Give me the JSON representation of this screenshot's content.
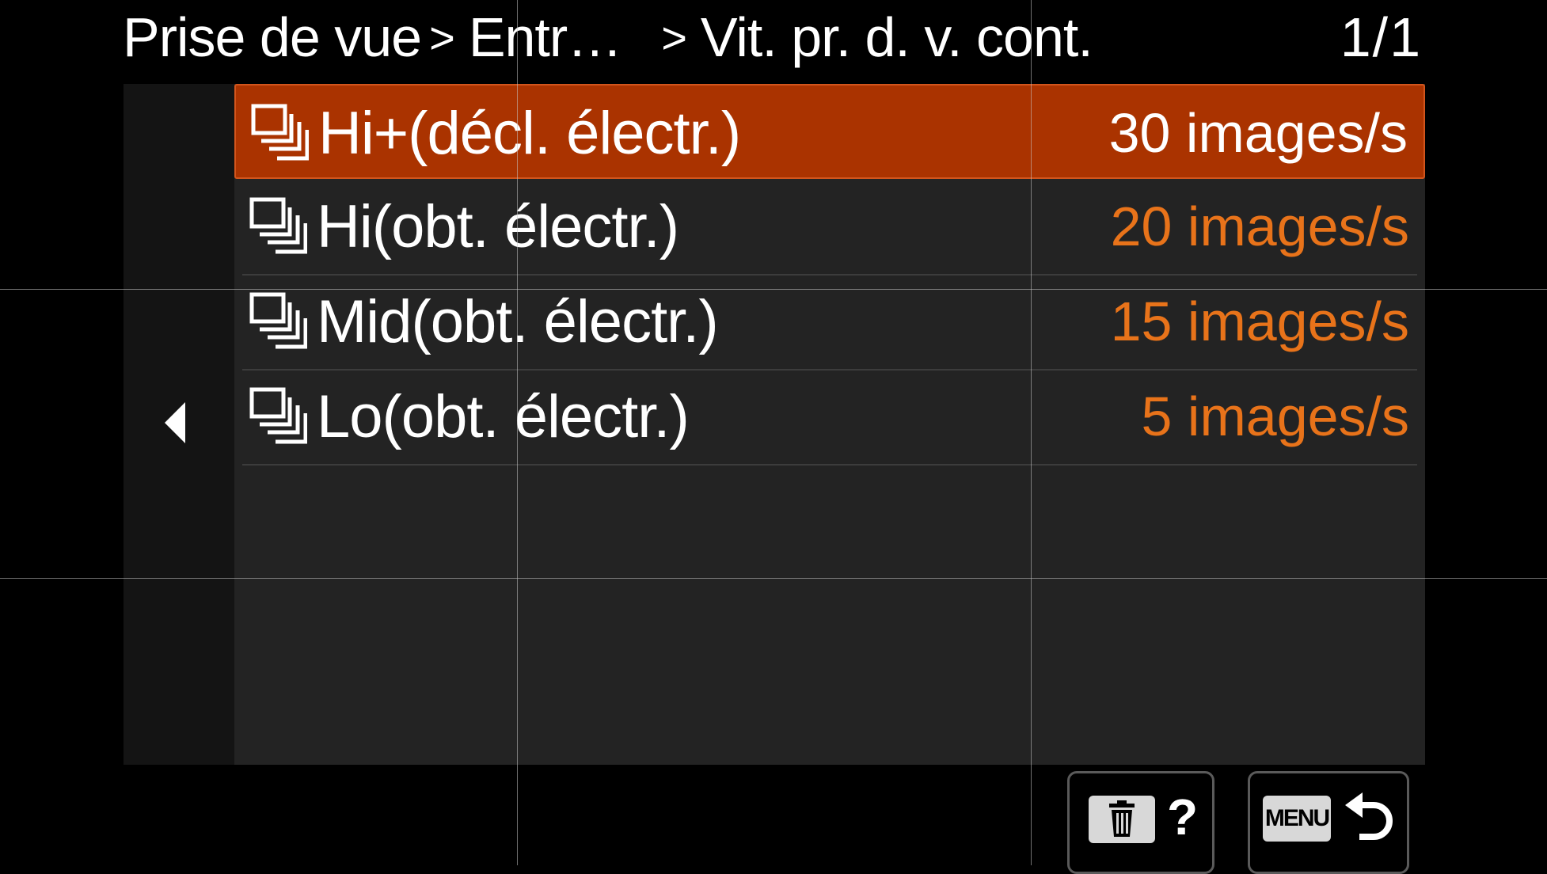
{
  "header": {
    "breadcrumb": [
      "Prise de vue",
      "Entr…",
      "Vit. pr. d. v. cont."
    ],
    "breadcrumb_separator": ">",
    "page_indicator": "1/1"
  },
  "accent_colors": {
    "selected_row_bg": "#aa3300",
    "value_text": "#e8731a",
    "selected_value_text": "#ffffff"
  },
  "list": {
    "items": [
      {
        "label": "Hi+(décl. électr.)",
        "value": "30 images/s",
        "icon": "continuous-shooting-icon",
        "selected": true
      },
      {
        "label": "Hi(obt. électr.)",
        "value": "20 images/s",
        "icon": "continuous-shooting-icon",
        "selected": false
      },
      {
        "label": "Mid(obt. électr.)",
        "value": "15 images/s",
        "icon": "continuous-shooting-icon",
        "selected": false
      },
      {
        "label": "Lo(obt. électr.)",
        "value": "5 images/s",
        "icon": "continuous-shooting-icon",
        "selected": false
      }
    ]
  },
  "footer": {
    "delete_help_button": {
      "icon": "trash-icon",
      "label": "?"
    },
    "menu_back_button": {
      "icon": "return-arrow-icon",
      "label": "MENU"
    }
  }
}
